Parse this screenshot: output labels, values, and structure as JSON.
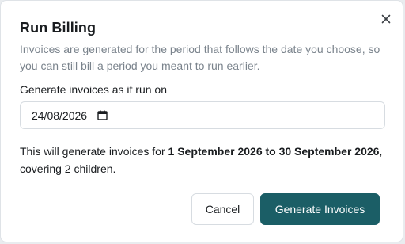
{
  "dialog": {
    "title": "Run Billing",
    "description": "Invoices are generated for the period that follows the date you choose, so you can still bill a period you meant to run earlier.",
    "close_icon": "close-icon",
    "field_label": "Generate invoices as if run on",
    "date_value": "24/08/2026",
    "calendar_icon": "calendar-icon",
    "summary": {
      "prefix": "This will generate invoices for ",
      "period": "1 September 2026 to 30 September 2026",
      "suffix": ", covering 2 children."
    },
    "buttons": {
      "cancel": "Cancel",
      "generate": "Generate Invoices"
    }
  },
  "colors": {
    "primary": "#1b5e66",
    "muted_text": "#7a838c",
    "border": "#d7dce1"
  }
}
